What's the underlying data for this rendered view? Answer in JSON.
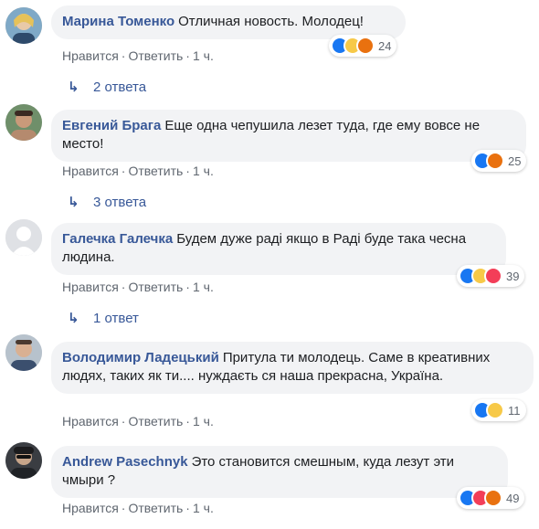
{
  "comments": [
    {
      "author": "Марина Томенко",
      "text": "Отличная новость. Молодец!",
      "like": "Нравится",
      "reply": "Ответить",
      "time": "1 ч.",
      "reaction_count": "24",
      "reactions": [
        "like",
        "haha",
        "angry"
      ],
      "replies": "2 ответа"
    },
    {
      "author": "Евгений Брага",
      "text": "Еще одна чепушила лезет туда, где ему вовсе не место!",
      "like": "Нравится",
      "reply": "Ответить",
      "time": "1 ч.",
      "reaction_count": "25",
      "reactions": [
        "like",
        "angry"
      ],
      "replies": "3 ответа"
    },
    {
      "author": "Галечка Галечка",
      "text": "Будем дуже раді якщо в Раді буде така чесна людина.",
      "like": "Нравится",
      "reply": "Ответить",
      "time": "1 ч.",
      "reaction_count": "39",
      "reactions": [
        "like",
        "haha",
        "love"
      ],
      "replies": "1 ответ"
    },
    {
      "author": "Володимир Ладецький",
      "text": "Притула ти молодець. Саме в креативних людях, таких як ти.... нуждаєть ся наша прекрасна, Україна.",
      "like": "Нравится",
      "reply": "Ответить",
      "time": "1 ч.",
      "reaction_count": "11",
      "reactions": [
        "like",
        "haha"
      ]
    },
    {
      "author": "Andrew Pasechnyk",
      "text": "Это становится смешным, куда лезут эти чмыри ?",
      "like": "Нравится",
      "reply": "Ответить",
      "time": "1 ч.",
      "reaction_count": "49",
      "reactions": [
        "like",
        "love",
        "angry"
      ]
    }
  ],
  "colors": {
    "author": "#385898",
    "bubble": "#f2f3f5",
    "meta": "#606770",
    "like": "#1877f2",
    "haha": "#f7c948",
    "angry": "#e9710f",
    "love": "#f33e58"
  }
}
